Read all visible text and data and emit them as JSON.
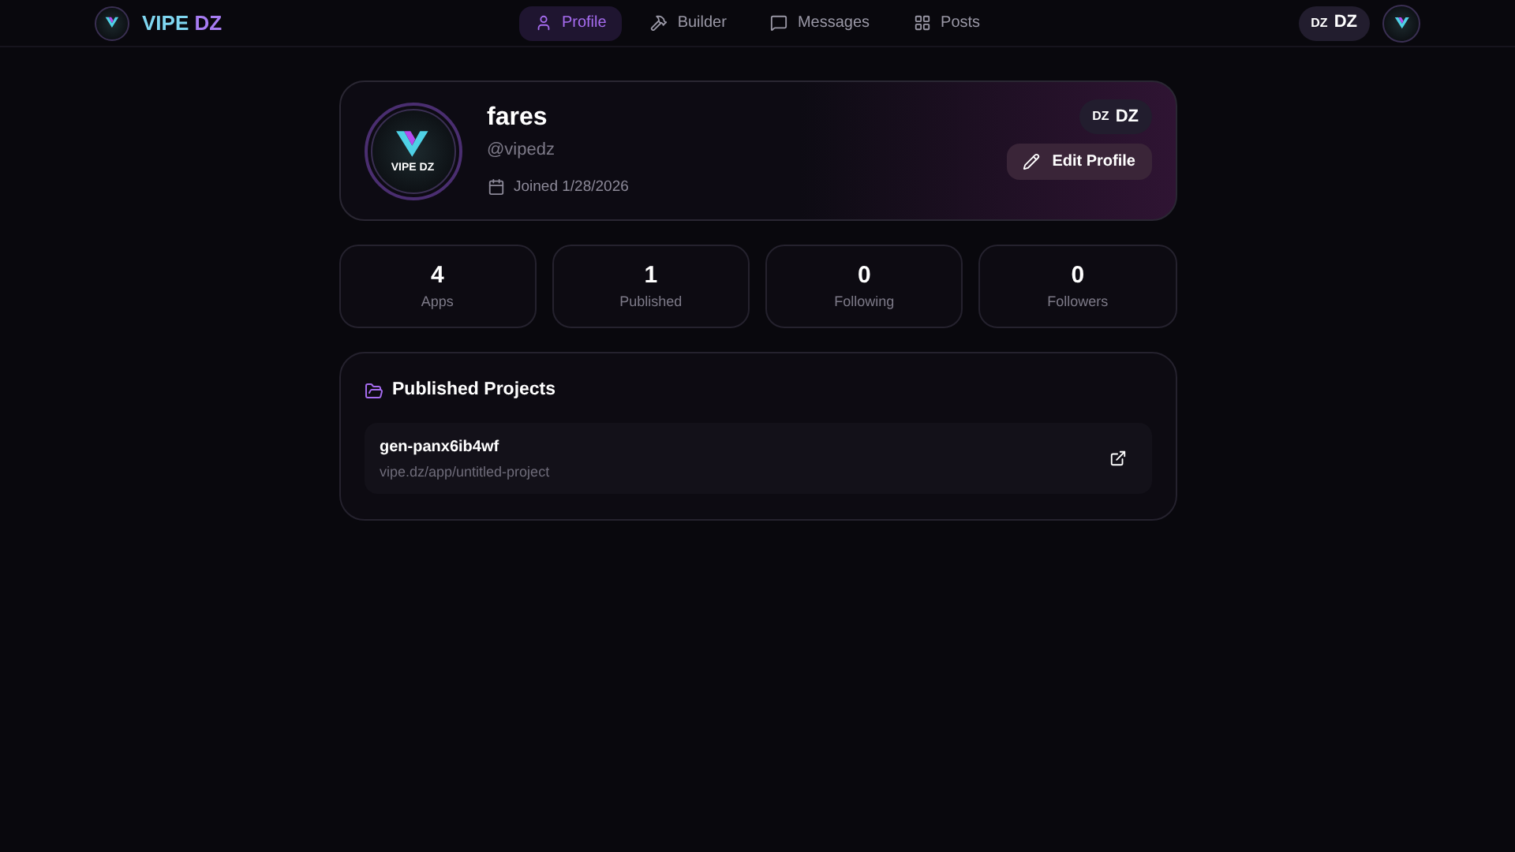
{
  "brand": {
    "name_first": "VIPE",
    "name_second": "DZ"
  },
  "nav": [
    {
      "label": "Profile",
      "selected": true
    },
    {
      "label": "Builder",
      "selected": false
    },
    {
      "label": "Messages",
      "selected": false
    },
    {
      "label": "Posts",
      "selected": false
    }
  ],
  "language_badge": {
    "prefix": "DZ",
    "label": "DZ"
  },
  "profile": {
    "name": "fares",
    "handle": "@vipedz",
    "joined": "Joined 1/28/2026",
    "avatar_text": "VIPE DZ",
    "language_badge": {
      "prefix": "DZ",
      "label": "DZ"
    },
    "edit_button": "Edit Profile"
  },
  "stats": [
    {
      "value": "4",
      "label": "Apps"
    },
    {
      "value": "1",
      "label": "Published"
    },
    {
      "value": "0",
      "label": "Following"
    },
    {
      "value": "0",
      "label": "Followers"
    }
  ],
  "published": {
    "title": "Published Projects",
    "projects": [
      {
        "name": "gen-panx6ib4wf",
        "url": "vipe.dz/app/untitled-project"
      }
    ]
  }
}
